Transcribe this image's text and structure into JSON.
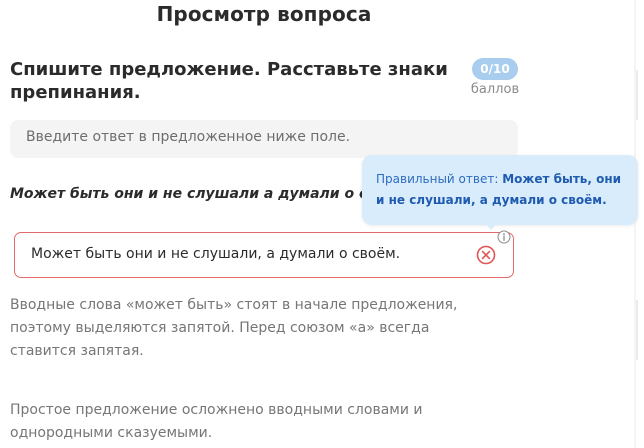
{
  "header": {
    "title": "Просмотр вопроса"
  },
  "task": {
    "title": "Спишите предложение. Расставьте знаки препинания.",
    "score": "0/10",
    "score_unit": "баллов",
    "hint": "Введите ответ в предложенное ниже поле.",
    "sentence": "Может быть они и не слушали а думали о своём."
  },
  "answer": {
    "value": "Может быть они и не слушали, а думали о своём.",
    "status": "incorrect"
  },
  "tooltip": {
    "label": "Правильный ответ:",
    "value": "Может быть, они и не слушали, а думали о своём."
  },
  "explanations": [
    "Вводные слова «может быть» стоят в начале предложения, поэтому выделяются запятой. Перед союзом «а» всегда ставится запятая.",
    "Простое предложение осложнено вводными словами и однородными сказуемыми."
  ],
  "colors": {
    "error": "#e36a6a",
    "badge": "#a9cdef",
    "tooltip_bg": "#d9ecfb",
    "tooltip_text": "#1f5bb0"
  },
  "icons": {
    "error": "circle-x-icon",
    "info": "info-icon"
  }
}
